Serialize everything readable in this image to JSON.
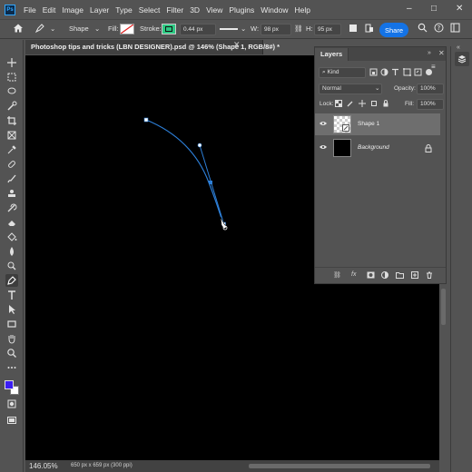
{
  "app": {
    "logo": "Ps"
  },
  "menu": [
    "File",
    "Edit",
    "Image",
    "Layer",
    "Type",
    "Select",
    "Filter",
    "3D",
    "View",
    "Plugins",
    "Window",
    "Help"
  ],
  "window_controls": {
    "minimize": "–",
    "maximize": "□",
    "close": "✕"
  },
  "options": {
    "mode": "Shape",
    "fill_label": "Fill:",
    "stroke_label": "Stroke:",
    "stroke_width": "0.44 px",
    "w_label": "W:",
    "w_value": "98 px",
    "h_label": "H:",
    "h_value": "95 px",
    "share": "Share"
  },
  "document": {
    "tab_title": "Photoshop tips and tricks (LBN DESIGNER).psd @ 146% (Shape 1, RGB/8#) *",
    "tab_close": "✕",
    "zoom": "146.05%",
    "size_info": "650 px x 659 px (300 ppi)"
  },
  "layers_panel": {
    "title": "Layers",
    "filter": "Kind",
    "blend_mode": "Normal",
    "opacity_label": "Opacity:",
    "opacity": "100%",
    "lock_label": "Lock:",
    "fill_label": "Fill:",
    "fill": "100%",
    "layers": [
      {
        "name": "Shape 1",
        "selected": true
      },
      {
        "name": "Background",
        "selected": false,
        "locked": true
      }
    ]
  },
  "colors": {
    "accent": "#1473e6",
    "path": "#2d7fd8",
    "foreground": "#3b1df2",
    "background": "#ffffff",
    "stroke_swatch": "#2dc983"
  }
}
